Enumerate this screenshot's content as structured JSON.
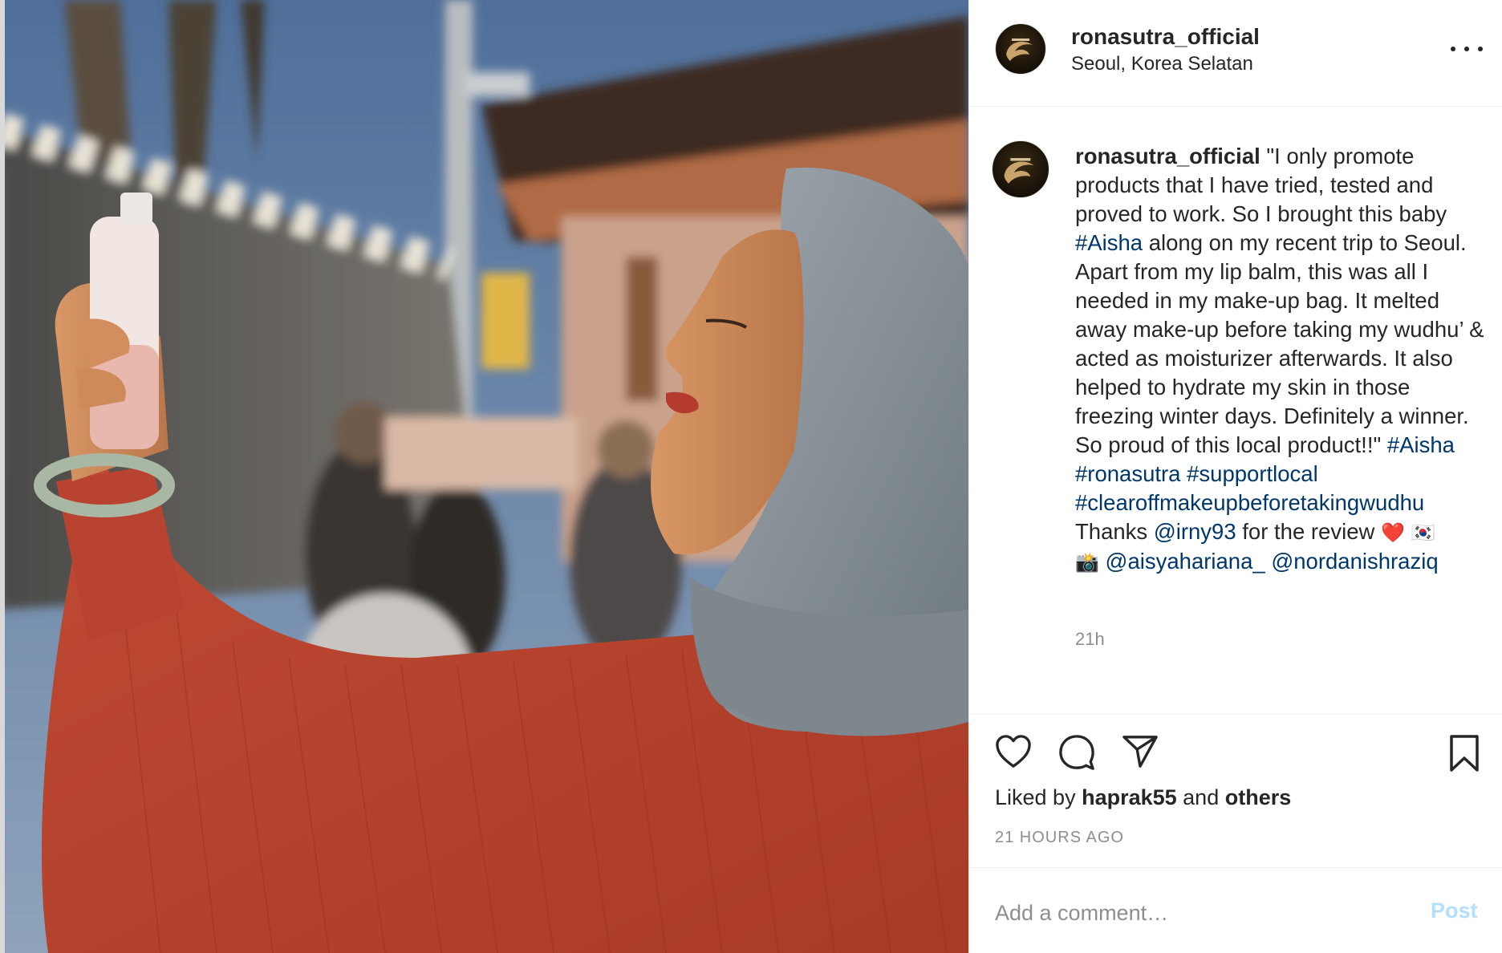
{
  "post": {
    "username": "ronasutra_official",
    "location": "Seoul, Korea Selatan",
    "more_icon": "more-horizontal-icon"
  },
  "caption": {
    "username": "ronasutra_official",
    "text_1": " \"I only promote products that I have tried, tested and proved to work. So I brought this baby ",
    "hashtag_1": "#Aisha",
    "text_2": " along on my recent trip to Seoul. Apart from my lip balm, this was all I needed in my make-up bag. It melted away make-up before taking my wudhu’ & acted as moisturizer afterwards. It also helped to hydrate my skin in those freezing winter days. Definitely a winner. So proud of this local product!!\" ",
    "hashtag_2": "#Aisha",
    "hashtag_3": "#ronasutra",
    "hashtag_4": "#supportlocal",
    "hashtag_5": "#clearoffmakeupbeforetakingwudhu",
    "thanks_prefix": "Thanks ",
    "mention_1": "@irny93",
    "thanks_suffix": " for the review ",
    "heart_emoji": "❤️",
    "flag_emoji": "🇰🇷",
    "camera_emoji": "📸",
    "mention_2": "@aisyahariana_",
    "mention_3": "@nordanishraziq",
    "time": "21h"
  },
  "actions": {
    "like_icon": "heart-icon",
    "comment_icon": "comment-icon",
    "share_icon": "share-icon",
    "save_icon": "bookmark-icon",
    "liked_prefix": "Liked by ",
    "liked_user": "haprak55",
    "liked_and": " and ",
    "liked_others": "others",
    "timestamp": "21 HOURS AGO"
  },
  "comment": {
    "placeholder": "Add a comment…",
    "post_label": "Post",
    "post_color": "#b2dffc"
  },
  "colors": {
    "link": "#00376b",
    "muted": "#8e8e8e",
    "text": "#262626"
  }
}
